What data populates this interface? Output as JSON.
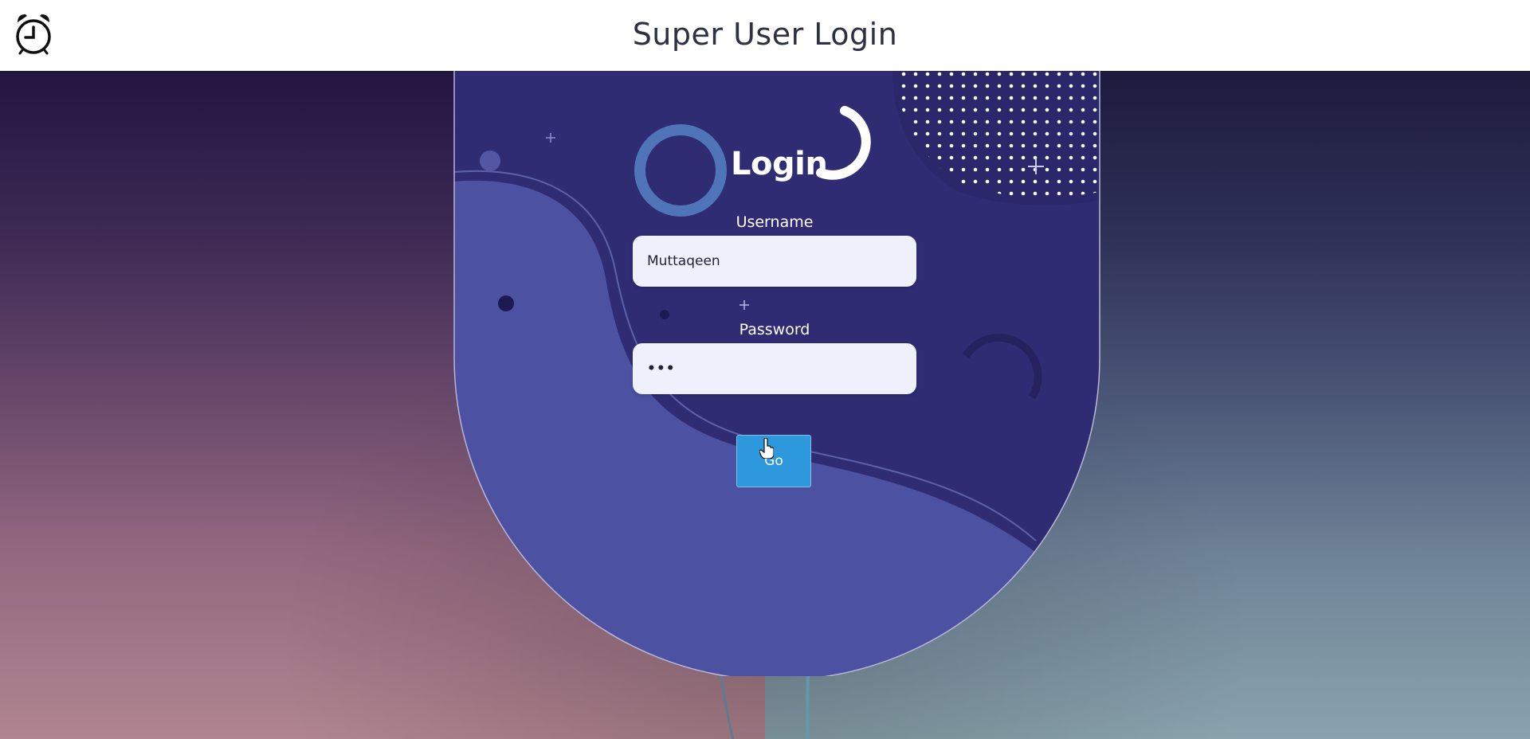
{
  "header": {
    "title": "Super User Login",
    "icon": "alarm-clock-icon"
  },
  "login_card": {
    "heading": "Login",
    "username": {
      "label": "Username",
      "value": "Muttaqeen"
    },
    "password": {
      "label": "Password",
      "value": "•••"
    },
    "submit_label": "Go"
  },
  "colors": {
    "card_dark": "#2f2c74",
    "card_wave": "#4c51a2",
    "button": "#2e98dc",
    "input_bg": "#eef1fb",
    "header_bg": "#ffffff"
  }
}
